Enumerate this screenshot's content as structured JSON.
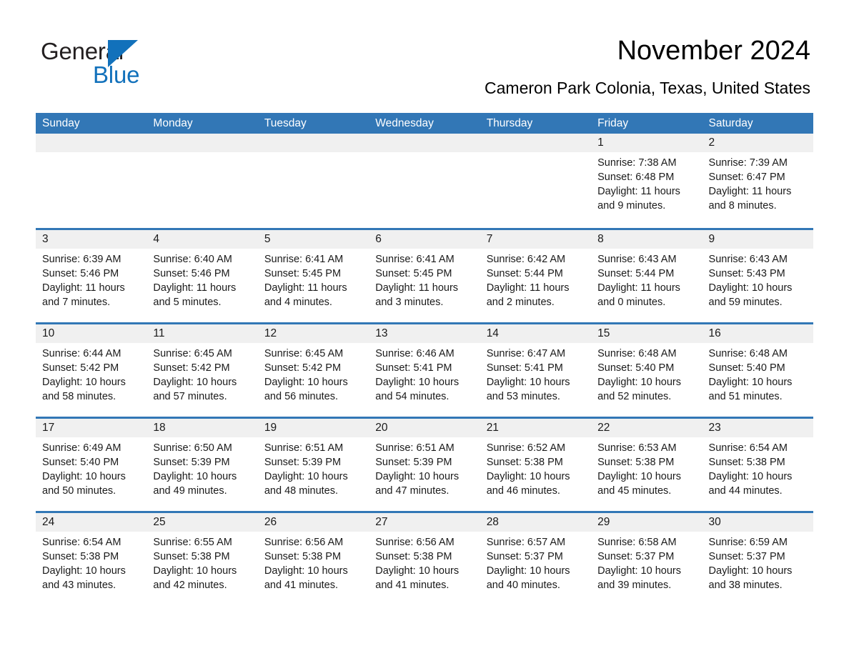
{
  "brand": {
    "word_one": "General",
    "word_two": "Blue",
    "triangle_color": "#1271bb",
    "text_color": "#231f20"
  },
  "header": {
    "title": "November 2024",
    "subtitle": "Cameron Park Colonia, Texas, United States"
  },
  "theme": {
    "header_blue": "#3277b6",
    "day_number_bar": "#f0f0f0",
    "cell_background": "#ffffff",
    "text_color": "#1a1a1a"
  },
  "weekdays": [
    "Sunday",
    "Monday",
    "Tuesday",
    "Wednesday",
    "Thursday",
    "Friday",
    "Saturday"
  ],
  "weeks": [
    [
      {
        "day": "",
        "lines": []
      },
      {
        "day": "",
        "lines": []
      },
      {
        "day": "",
        "lines": []
      },
      {
        "day": "",
        "lines": []
      },
      {
        "day": "",
        "lines": []
      },
      {
        "day": "1",
        "lines": [
          "Sunrise: 7:38 AM",
          "Sunset: 6:48 PM",
          "Daylight: 11 hours",
          "and 9 minutes."
        ]
      },
      {
        "day": "2",
        "lines": [
          "Sunrise: 7:39 AM",
          "Sunset: 6:47 PM",
          "Daylight: 11 hours",
          "and 8 minutes."
        ]
      }
    ],
    [
      {
        "day": "3",
        "lines": [
          "Sunrise: 6:39 AM",
          "Sunset: 5:46 PM",
          "Daylight: 11 hours",
          "and 7 minutes."
        ]
      },
      {
        "day": "4",
        "lines": [
          "Sunrise: 6:40 AM",
          "Sunset: 5:46 PM",
          "Daylight: 11 hours",
          "and 5 minutes."
        ]
      },
      {
        "day": "5",
        "lines": [
          "Sunrise: 6:41 AM",
          "Sunset: 5:45 PM",
          "Daylight: 11 hours",
          "and 4 minutes."
        ]
      },
      {
        "day": "6",
        "lines": [
          "Sunrise: 6:41 AM",
          "Sunset: 5:45 PM",
          "Daylight: 11 hours",
          "and 3 minutes."
        ]
      },
      {
        "day": "7",
        "lines": [
          "Sunrise: 6:42 AM",
          "Sunset: 5:44 PM",
          "Daylight: 11 hours",
          "and 2 minutes."
        ]
      },
      {
        "day": "8",
        "lines": [
          "Sunrise: 6:43 AM",
          "Sunset: 5:44 PM",
          "Daylight: 11 hours",
          "and 0 minutes."
        ]
      },
      {
        "day": "9",
        "lines": [
          "Sunrise: 6:43 AM",
          "Sunset: 5:43 PM",
          "Daylight: 10 hours",
          "and 59 minutes."
        ]
      }
    ],
    [
      {
        "day": "10",
        "lines": [
          "Sunrise: 6:44 AM",
          "Sunset: 5:42 PM",
          "Daylight: 10 hours",
          "and 58 minutes."
        ]
      },
      {
        "day": "11",
        "lines": [
          "Sunrise: 6:45 AM",
          "Sunset: 5:42 PM",
          "Daylight: 10 hours",
          "and 57 minutes."
        ]
      },
      {
        "day": "12",
        "lines": [
          "Sunrise: 6:45 AM",
          "Sunset: 5:42 PM",
          "Daylight: 10 hours",
          "and 56 minutes."
        ]
      },
      {
        "day": "13",
        "lines": [
          "Sunrise: 6:46 AM",
          "Sunset: 5:41 PM",
          "Daylight: 10 hours",
          "and 54 minutes."
        ]
      },
      {
        "day": "14",
        "lines": [
          "Sunrise: 6:47 AM",
          "Sunset: 5:41 PM",
          "Daylight: 10 hours",
          "and 53 minutes."
        ]
      },
      {
        "day": "15",
        "lines": [
          "Sunrise: 6:48 AM",
          "Sunset: 5:40 PM",
          "Daylight: 10 hours",
          "and 52 minutes."
        ]
      },
      {
        "day": "16",
        "lines": [
          "Sunrise: 6:48 AM",
          "Sunset: 5:40 PM",
          "Daylight: 10 hours",
          "and 51 minutes."
        ]
      }
    ],
    [
      {
        "day": "17",
        "lines": [
          "Sunrise: 6:49 AM",
          "Sunset: 5:40 PM",
          "Daylight: 10 hours",
          "and 50 minutes."
        ]
      },
      {
        "day": "18",
        "lines": [
          "Sunrise: 6:50 AM",
          "Sunset: 5:39 PM",
          "Daylight: 10 hours",
          "and 49 minutes."
        ]
      },
      {
        "day": "19",
        "lines": [
          "Sunrise: 6:51 AM",
          "Sunset: 5:39 PM",
          "Daylight: 10 hours",
          "and 48 minutes."
        ]
      },
      {
        "day": "20",
        "lines": [
          "Sunrise: 6:51 AM",
          "Sunset: 5:39 PM",
          "Daylight: 10 hours",
          "and 47 minutes."
        ]
      },
      {
        "day": "21",
        "lines": [
          "Sunrise: 6:52 AM",
          "Sunset: 5:38 PM",
          "Daylight: 10 hours",
          "and 46 minutes."
        ]
      },
      {
        "day": "22",
        "lines": [
          "Sunrise: 6:53 AM",
          "Sunset: 5:38 PM",
          "Daylight: 10 hours",
          "and 45 minutes."
        ]
      },
      {
        "day": "23",
        "lines": [
          "Sunrise: 6:54 AM",
          "Sunset: 5:38 PM",
          "Daylight: 10 hours",
          "and 44 minutes."
        ]
      }
    ],
    [
      {
        "day": "24",
        "lines": [
          "Sunrise: 6:54 AM",
          "Sunset: 5:38 PM",
          "Daylight: 10 hours",
          "and 43 minutes."
        ]
      },
      {
        "day": "25",
        "lines": [
          "Sunrise: 6:55 AM",
          "Sunset: 5:38 PM",
          "Daylight: 10 hours",
          "and 42 minutes."
        ]
      },
      {
        "day": "26",
        "lines": [
          "Sunrise: 6:56 AM",
          "Sunset: 5:38 PM",
          "Daylight: 10 hours",
          "and 41 minutes."
        ]
      },
      {
        "day": "27",
        "lines": [
          "Sunrise: 6:56 AM",
          "Sunset: 5:38 PM",
          "Daylight: 10 hours",
          "and 41 minutes."
        ]
      },
      {
        "day": "28",
        "lines": [
          "Sunrise: 6:57 AM",
          "Sunset: 5:37 PM",
          "Daylight: 10 hours",
          "and 40 minutes."
        ]
      },
      {
        "day": "29",
        "lines": [
          "Sunrise: 6:58 AM",
          "Sunset: 5:37 PM",
          "Daylight: 10 hours",
          "and 39 minutes."
        ]
      },
      {
        "day": "30",
        "lines": [
          "Sunrise: 6:59 AM",
          "Sunset: 5:37 PM",
          "Daylight: 10 hours",
          "and 38 minutes."
        ]
      }
    ]
  ]
}
